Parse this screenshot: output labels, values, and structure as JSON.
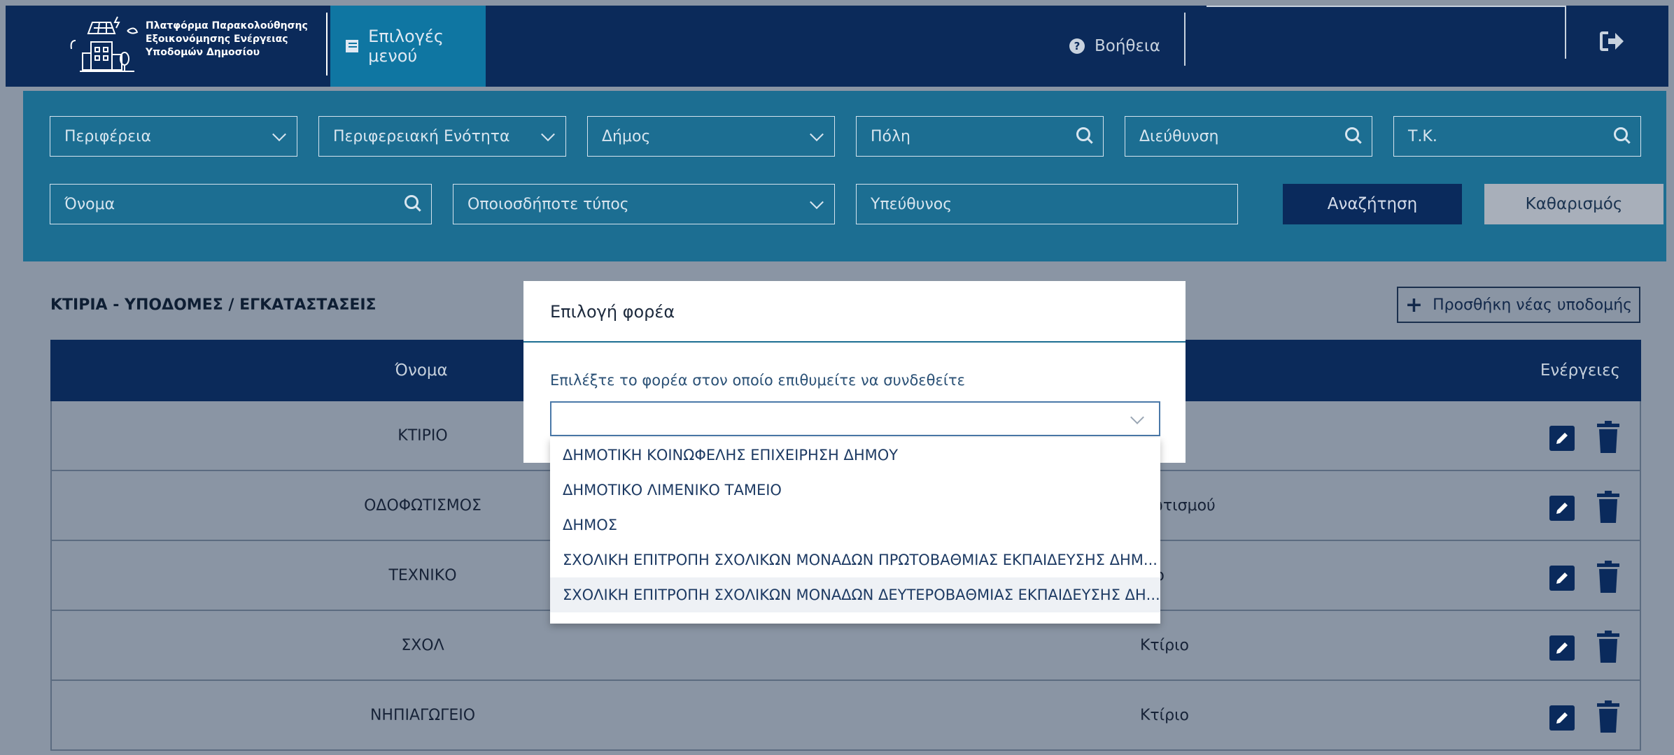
{
  "header": {
    "logo_lines": [
      "Πλατφόρμα Παρακολούθησης",
      "Εξοικονόμησης Ενέργειας",
      "Υποδομών Δημοσίου"
    ],
    "menu_label": "Επιλογές μενού",
    "help_label": "Βοήθεια",
    "logout_icon": "sign-out-icon"
  },
  "filters": {
    "region": "Περιφέρεια",
    "regional_unit": "Περιφερειακή Ενότητα",
    "municipality": "Δήμος",
    "city": "Πόλη",
    "address": "Διεύθυνση",
    "postal_code": "Τ.Κ.",
    "name": "Όνομα",
    "type": "Οποιοσδήποτε τύπος",
    "responsible": "Υπεύθυνος",
    "search_button": "Αναζήτηση",
    "clear_button": "Καθαρισμός"
  },
  "section": {
    "title": "ΚΤΙΡΙΑ - ΥΠΟΔΟΜΕΣ / ΕΓΚΑΤΑΣΤΑΣΕΙΣ",
    "add_button": "Προσθήκη νέας υποδομής"
  },
  "table": {
    "columns": {
      "name": "Όνομα",
      "actions": "Ενέργειες"
    },
    "rows": [
      {
        "name": "ΚΤΙΡΙΟ",
        "type": ""
      },
      {
        "name": "ΟΔΟΦΩΤΙΣΜΟΣ",
        "type": "φωτισμού"
      },
      {
        "name": "ΤΕΧΝΙΚΟ",
        "type": "ριο"
      },
      {
        "name": "ΣΧΟΛ",
        "type": "Κτίριο"
      },
      {
        "name": "ΝΗΠΙΑΓΩΓΕΙΟ",
        "type": "Κτίριο"
      }
    ]
  },
  "modal": {
    "title": "Επιλογή φορέα",
    "label": "Επιλέξτε το φορέα στον οποίο επιθυμείτε να συνδεθείτε",
    "selected_value": "",
    "options": [
      "ΔΗΜΟΤΙΚΗ ΚΟΙΝΩΦΕΛΗΣ ΕΠΙΧΕΙΡΗΣΗ ΔΗΜΟΥ",
      "ΔΗΜΟΤΙΚΟ ΛΙΜΕΝΙΚΟ ΤΑΜΕΙΟ",
      "ΔΗΜΟΣ",
      "ΣΧΟΛΙΚΗ ΕΠΙΤΡΟΠΗ ΣΧΟΛΙΚΩΝ ΜΟΝΑΔΩΝ ΠΡΩΤΟΒΑΘΜΙΑΣ ΕΚΠΑΙΔΕΥΣΗΣ ΔΗΜ...",
      "ΣΧΟΛΙΚΗ ΕΠΙΤΡΟΠΗ ΣΧΟΛΙΚΩΝ ΜΟΝΑΔΩΝ ΔΕΥΤΕΡΟΒΑΘΜΙΑΣ ΕΚΠΑΙΔΕΥΣΗΣ ΔΗ..."
    ]
  },
  "colors": {
    "navbar": "#0b2a5a",
    "menu_active": "#0f76a2",
    "filter_panel": "#1c6e92",
    "page_dimmed": "#8a95a4"
  }
}
